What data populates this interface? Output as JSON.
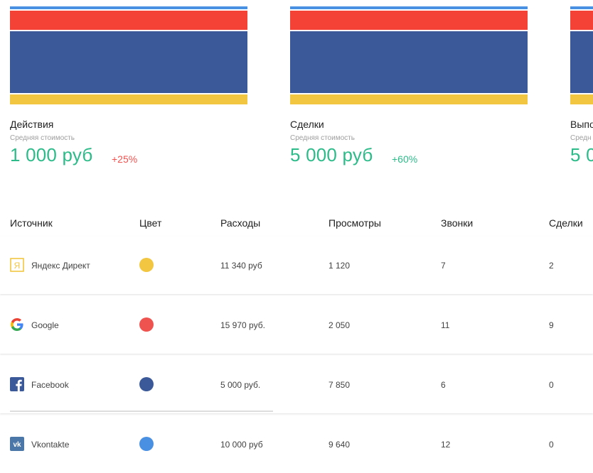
{
  "cards": [
    {
      "title": "Действия",
      "subtitle": "Средняя стоимость",
      "value": "1 000 руб",
      "delta": "+25%",
      "delta_type": "negative",
      "bar_colors": [
        "#4a90e2",
        "#f44336",
        "#3b5998",
        "#f2c641"
      ]
    },
    {
      "title": "Сделки",
      "subtitle": "Средняя стоимость",
      "value": "5 000 руб",
      "delta": "+60%",
      "delta_type": "positive",
      "bar_colors": [
        "#4a90e2",
        "#f44336",
        "#3b5998",
        "#f2c641"
      ]
    },
    {
      "title": "Выпо",
      "subtitle": "Средн",
      "value": "5 0",
      "delta": "",
      "delta_type": "positive",
      "bar_colors": [
        "#4a90e2",
        "#f44336",
        "#3b5998",
        "#f2c641"
      ]
    }
  ],
  "table": {
    "headers": [
      "Источник",
      "Цвет",
      "Расходы",
      "Просмотры",
      "Звонки",
      "Сделки"
    ],
    "rows": [
      {
        "source": "Яндекс Директ",
        "icon": "yandex-icon",
        "color": "#f2c641",
        "expenses": "11 340 руб",
        "views": "1 120",
        "calls": "7",
        "deals": "2"
      },
      {
        "source": "Google",
        "icon": "google-icon",
        "color": "#ef5350",
        "expenses": "15 970 руб.",
        "views": "2 050",
        "calls": "11",
        "deals": "9"
      },
      {
        "source": "Facebook",
        "icon": "facebook-icon",
        "color": "#3b5998",
        "expenses": "5 000 руб.",
        "views": "7 850",
        "calls": "6",
        "deals": "0"
      },
      {
        "source": "Vkontakte",
        "icon": "vk-icon",
        "color": "#4a90e2",
        "expenses": "10 000 руб",
        "views": "9 640",
        "calls": "12",
        "deals": "0"
      }
    ]
  },
  "colors": {
    "accent_green": "#2dbb8a",
    "accent_red": "#ef5350"
  }
}
